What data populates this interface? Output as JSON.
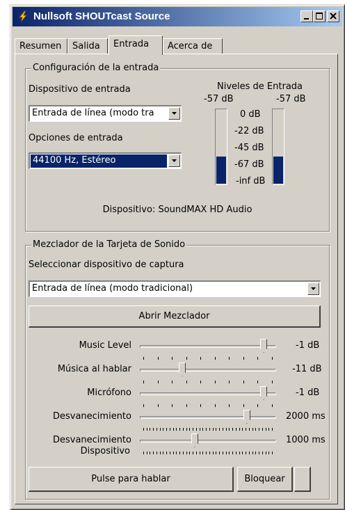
{
  "window": {
    "title": "Nullsoft SHOUTcast Source"
  },
  "tabs": [
    {
      "label": "Resumen"
    },
    {
      "label": "Salida"
    },
    {
      "label": "Entrada"
    },
    {
      "label": "Acerca de"
    }
  ],
  "active_tab": "Entrada",
  "input_config": {
    "legend": "Configuración de la entrada",
    "device_label": "Dispositivo de entrada",
    "device_value": "Entrada de línea (modo tra",
    "options_label": "Opciones de entrada",
    "options_value": "44100 Hz, Estéreo",
    "levels_label": "Niveles de Entrada",
    "left_level": "-57 dB",
    "right_level": "-57 dB",
    "scale": [
      "0 dB",
      "-22 dB",
      "-45 dB",
      "-67 dB",
      "-inf dB"
    ],
    "left_meter_fill": 0.36,
    "right_meter_fill": 0.36,
    "device_info": "Dispositivo: SoundMAX HD Audio"
  },
  "mixer": {
    "legend": "Mezclador de la Tarjeta de Sonido",
    "capture_label": "Seleccionar dispositivo de captura",
    "capture_value": "Entrada de línea (modo tradicional)",
    "open_mixer": "Abrir Mezclador",
    "sliders": [
      {
        "label": "Music Level",
        "value": "-1 dB",
        "position": 0.93,
        "ticks": 10
      },
      {
        "label": "Música al hablar",
        "value": "-11 dB",
        "position": 0.3,
        "ticks": 10
      },
      {
        "label": "Micrófono",
        "value": "-1 dB",
        "position": 0.93,
        "ticks": 10
      },
      {
        "label": "Desvanecimiento",
        "value": "2000 ms",
        "position": 0.8,
        "ticks": 40
      },
      {
        "label": "Desvanecimiento",
        "label2": "Dispositivo",
        "value": "1000 ms",
        "position": 0.4,
        "ticks": 40
      }
    ],
    "push_to_talk": "Pulse para hablar",
    "lock": "Bloquear"
  },
  "colors": {
    "face": "#d4d0c8",
    "title_start": "#0a246a",
    "title_end": "#a6caf0",
    "selection": "#0a246a"
  }
}
